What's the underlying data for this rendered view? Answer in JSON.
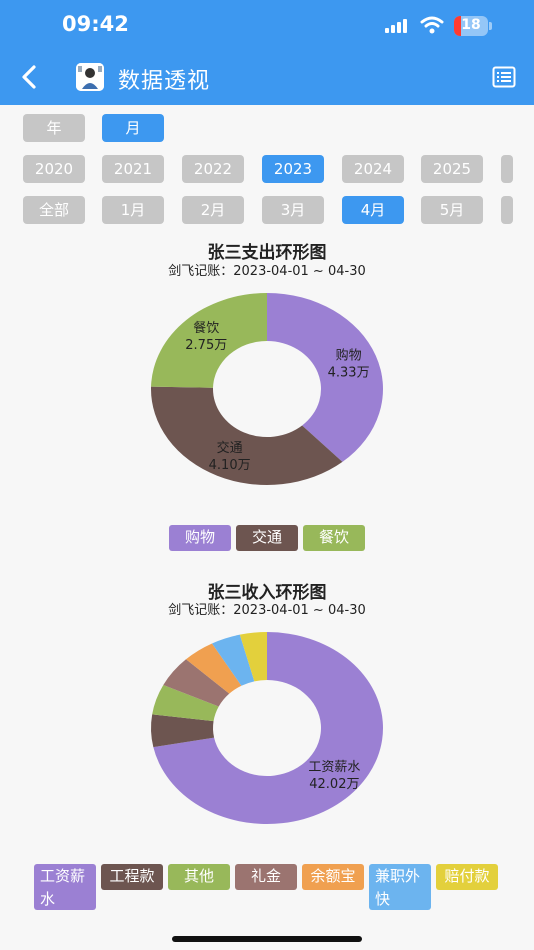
{
  "status": {
    "time": "09:42",
    "battery": "18"
  },
  "header": {
    "title": "数据透视",
    "avatar_text": "剑飞 记账"
  },
  "period_tabs": [
    {
      "label": "年",
      "active": false
    },
    {
      "label": "月",
      "active": true
    }
  ],
  "years": [
    {
      "label": "2020",
      "active": false
    },
    {
      "label": "2021",
      "active": false
    },
    {
      "label": "2022",
      "active": false
    },
    {
      "label": "2023",
      "active": true
    },
    {
      "label": "2024",
      "active": false
    },
    {
      "label": "2025",
      "active": false
    }
  ],
  "months": [
    {
      "label": "全部",
      "active": false
    },
    {
      "label": "1月",
      "active": false
    },
    {
      "label": "2月",
      "active": false
    },
    {
      "label": "3月",
      "active": false
    },
    {
      "label": "4月",
      "active": true
    },
    {
      "label": "5月",
      "active": false
    }
  ],
  "chart_data": [
    {
      "type": "pie",
      "title": "张三支出环形图",
      "subtitle": "剑飞记账：2023-04-01 ~ 04-30",
      "unit": "万",
      "labels": [
        "购物",
        "交通",
        "餐饮"
      ],
      "values": [
        4.33,
        4.1,
        2.75
      ],
      "value_labels": [
        "4.33万",
        "4.10万",
        "2.75万"
      ],
      "colors": [
        "#9b80d3",
        "#6d5550",
        "#98b85a"
      ],
      "slice_labels_shown": [
        true,
        true,
        true
      ],
      "legend": "bottom"
    },
    {
      "type": "pie",
      "title": "张三收入环形图",
      "subtitle": "剑飞记账：2023-04-01 ~ 04-30",
      "unit": "万",
      "labels": [
        "工资薪水",
        "工程款",
        "其他",
        "礼金",
        "余额宝",
        "兼职外快",
        "赔付款"
      ],
      "values": [
        42.02,
        3.2,
        3.0,
        3.1,
        2.6,
        2.4,
        2.2
      ],
      "value_labels": [
        "42.02万",
        "",
        "",
        "",
        "",
        "",
        ""
      ],
      "colors": [
        "#9b80d3",
        "#6d5550",
        "#98b85a",
        "#9b7470",
        "#f0a050",
        "#6cb4ef",
        "#e3d03c"
      ],
      "slice_labels_shown": [
        true,
        false,
        false,
        false,
        false,
        false,
        false
      ],
      "legend": "bottom"
    }
  ]
}
